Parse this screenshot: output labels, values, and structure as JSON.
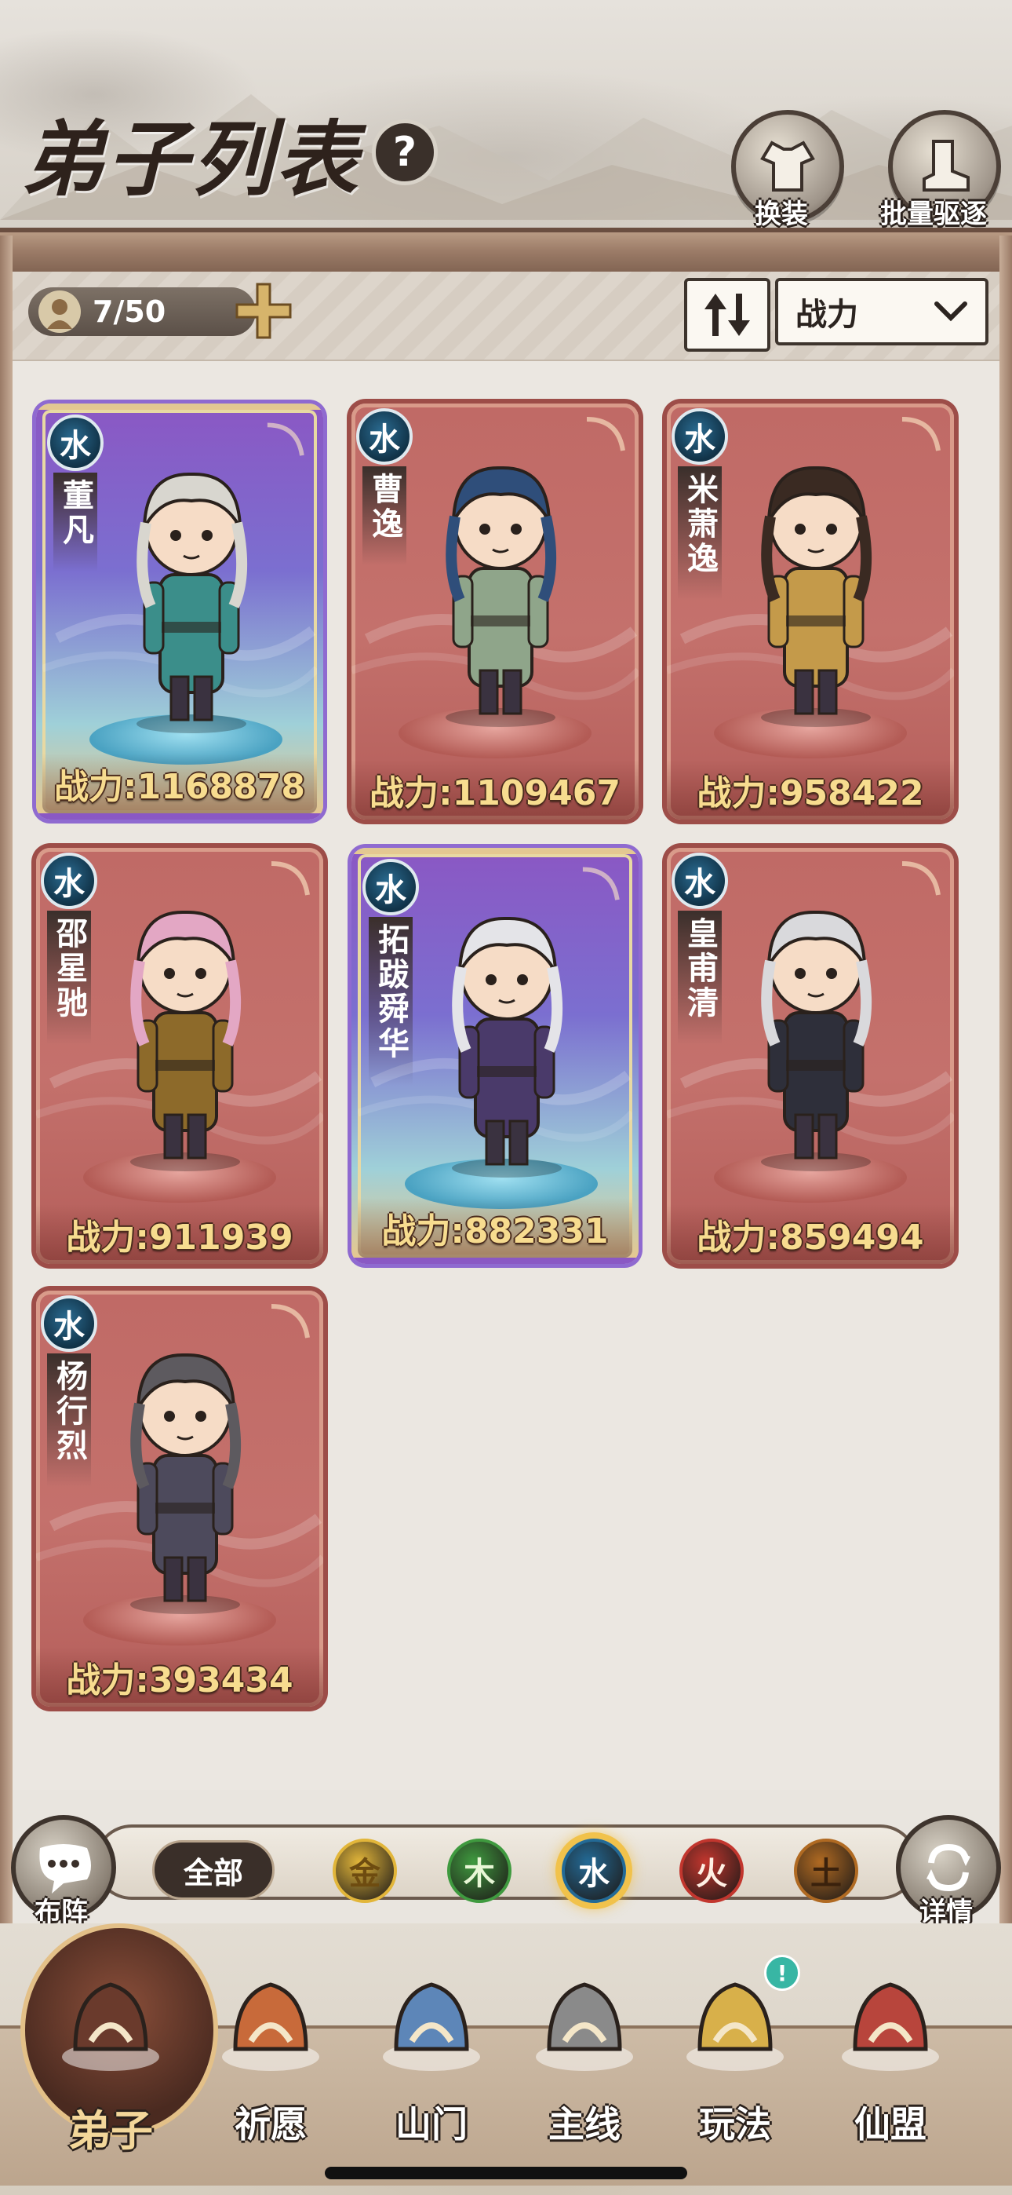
{
  "header": {
    "title": "弟子列表",
    "help_label": "?",
    "buttons": [
      {
        "id": "outfit",
        "label": "换装",
        "icon": "outfit-icon"
      },
      {
        "id": "batch_dismiss",
        "label": "批量驱逐",
        "icon": "boot-icon"
      }
    ]
  },
  "toolbar": {
    "count": "7/50",
    "sort_selected": "战力"
  },
  "disciples": [
    {
      "name": "董凡",
      "element": "水",
      "power": "战力:1168878",
      "rarity": "purple",
      "hair": "#d8d6cf",
      "robe": "#3b8e8a"
    },
    {
      "name": "曹逸",
      "element": "水",
      "power": "战力:1109467",
      "rarity": "red",
      "hair": "#2f4e7a",
      "robe": "#8fa58a"
    },
    {
      "name": "米萧逸",
      "element": "水",
      "power": "战力:958422",
      "rarity": "red",
      "hair": "#3a2a22",
      "robe": "#c49a4a"
    },
    {
      "name": "邵星驰",
      "element": "水",
      "power": "战力:911939",
      "rarity": "red",
      "hair": "#e3a7c4",
      "robe": "#8d6a2a"
    },
    {
      "name": "拓跋舜华",
      "element": "水",
      "power": "战力:882331",
      "rarity": "purple",
      "hair": "#e4e4e8",
      "robe": "#4a3a6a"
    },
    {
      "name": "皇甫清",
      "element": "水",
      "power": "战力:859494",
      "rarity": "red",
      "hair": "#d9d9dc",
      "robe": "#2e2f3a"
    },
    {
      "name": "杨行烈",
      "element": "水",
      "power": "战力:393434",
      "rarity": "red",
      "hair": "#5d5a5f",
      "robe": "#4d4a5c"
    }
  ],
  "filter": {
    "left_button": "布阵",
    "right_button": "详情",
    "all_label": "全部",
    "elements": [
      {
        "label": "金",
        "color": "#e2b63a",
        "text": "#6e4c10",
        "selected": false
      },
      {
        "label": "木",
        "color": "#3f9a3f",
        "text": "#e8f7d6",
        "selected": false
      },
      {
        "label": "水",
        "color": "#236a96",
        "text": "#ffffff",
        "selected": true
      },
      {
        "label": "火",
        "color": "#c2362e",
        "text": "#fff0e4",
        "selected": false
      },
      {
        "label": "土",
        "color": "#b06a22",
        "text": "#3a210c",
        "selected": false
      }
    ]
  },
  "nav": {
    "items": [
      {
        "label": "弟子",
        "icon": "disciple-icon",
        "active": true
      },
      {
        "label": "祈愿",
        "icon": "scroll-icon",
        "active": false
      },
      {
        "label": "山门",
        "icon": "gate-icon",
        "active": false
      },
      {
        "label": "主线",
        "icon": "mountain-sword-icon",
        "active": false
      },
      {
        "label": "玩法",
        "icon": "map-icon",
        "active": false,
        "badge": "!"
      },
      {
        "label": "仙盟",
        "icon": "alliance-banner-icon",
        "active": false
      }
    ]
  }
}
